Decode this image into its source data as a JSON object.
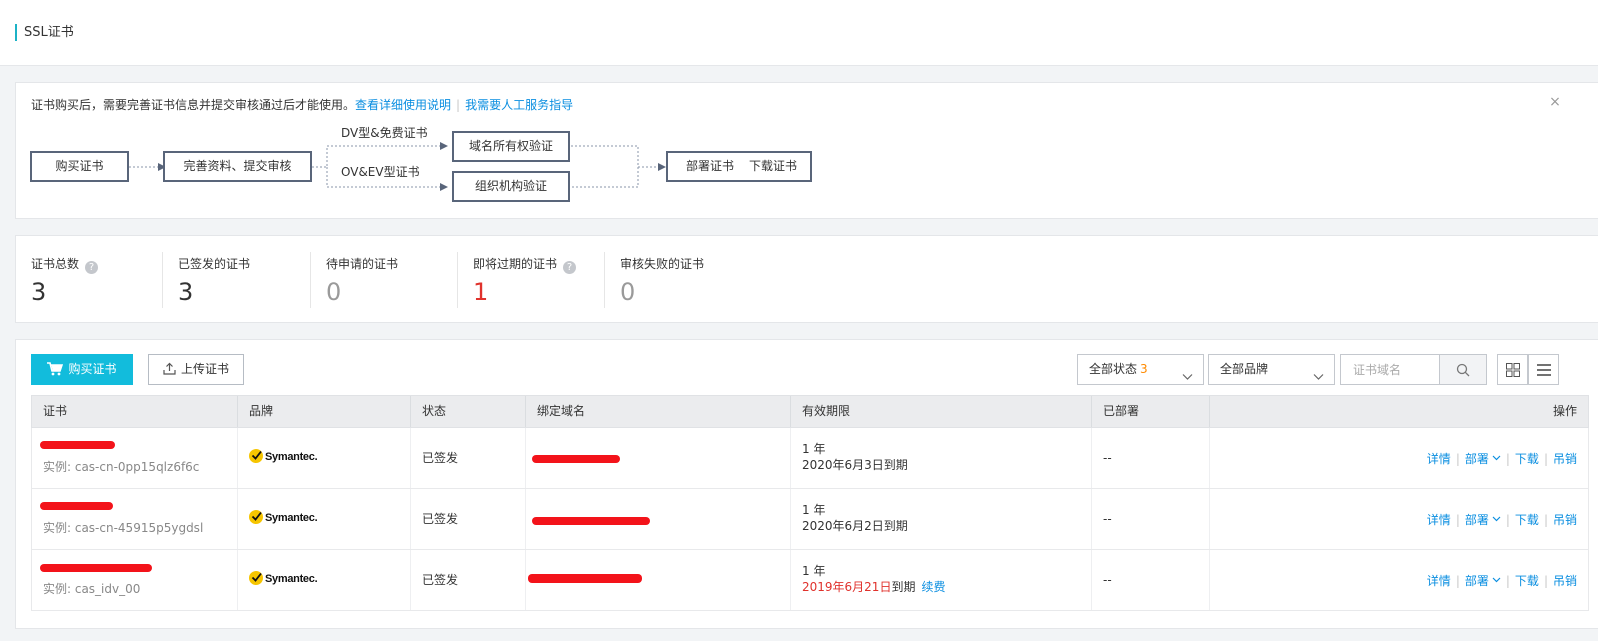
{
  "header": {
    "title": "SSL证书"
  },
  "notice": {
    "message": "证书购买后，需要完善证书信息并提交审核通过后才能使用。",
    "link_docs": "查看详细使用说明",
    "link_help": "我需要人工服务指导",
    "close_icon": "close-icon",
    "flow": {
      "step_buy": "购买证书",
      "step_complete": "完善资料、提交审核",
      "branch_dv": "DV型&免费证书",
      "branch_ov": "OV&EV型证书",
      "step_domain": "域名所有权验证",
      "step_org": "组织机构验证",
      "step_deploy": "部署证书",
      "step_download": "下载证书"
    }
  },
  "stats": [
    {
      "label": "证书总数",
      "value": "3",
      "help": true
    },
    {
      "label": "已签发的证书",
      "value": "3",
      "help": false
    },
    {
      "label": "待申请的证书",
      "value": "0",
      "help": false
    },
    {
      "label": "即将过期的证书",
      "value": "1",
      "help": true
    },
    {
      "label": "审核失败的证书",
      "value": "0",
      "help": false
    }
  ],
  "toolbar": {
    "buy_label": "购买证书",
    "upload_label": "上传证书",
    "status_filter": "全部状态",
    "status_count": "3",
    "brand_filter": "全部品牌",
    "search_placeholder": "证书域名"
  },
  "table": {
    "columns": [
      "证书",
      "品牌",
      "状态",
      "绑定域名",
      "有效期限",
      "已部署",
      "操作"
    ],
    "rows": [
      {
        "instance": "实例: cas-cn-0pp15qlz6f6c",
        "brand": "Symantec.",
        "status": "已签发",
        "term": "1 年",
        "expiry": "2020年6月3日到期",
        "expiry_warn": false,
        "deployed": "--"
      },
      {
        "instance": "实例: cas-cn-45915p5ygdsl",
        "brand": "Symantec.",
        "status": "已签发",
        "term": "1 年",
        "expiry": "2020年6月2日到期",
        "expiry_warn": false,
        "deployed": "--"
      },
      {
        "instance": "实例: cas_idv_00",
        "brand": "Symantec.",
        "status": "已签发",
        "term": "1 年",
        "expiry_date": "2019年6月21日",
        "expiry_suffix": "到期",
        "renew": "续费",
        "expiry_warn": true,
        "deployed": "--"
      }
    ],
    "actions": {
      "detail": "详情",
      "deploy": "部署",
      "download": "下载",
      "revoke": "吊销"
    }
  },
  "colors": {
    "accent": "#12bcdc",
    "link": "#0a8ee0",
    "warn": "#e0322c",
    "count": "#ff8a00"
  }
}
